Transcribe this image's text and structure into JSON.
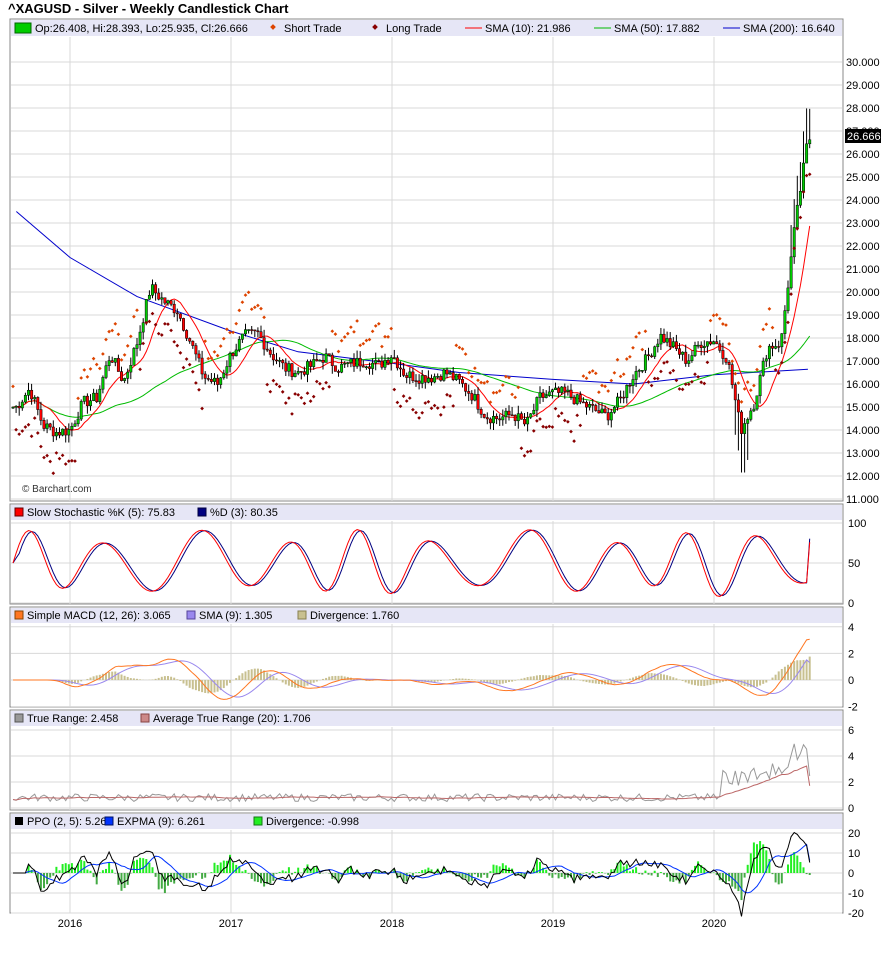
{
  "title": "^XAGUSD - Silver - Weekly Candlestick Chart",
  "colors": {
    "up": "#00cc00",
    "down": "#ff0000",
    "sma10": "#ff0000",
    "sma50": "#00bb00",
    "sma200": "#0000cc",
    "short": "#dd4400",
    "long": "#880000",
    "band": "#e6e6f6"
  },
  "chart_data": [
    {
      "panel": "price",
      "type": "candlestick",
      "legend": [
        "Op:26.408, Hi:28.393, Lo:25.935, Cl:26.666",
        "Short Trade",
        "Long Trade",
        "SMA (10): 21.986",
        "SMA (50): 17.882",
        "SMA (200): 16.640"
      ],
      "last_price_label": "26.666",
      "watermark": "© Barchart.com",
      "ylim": [
        11,
        30
      ],
      "yticks": [
        "11.000",
        "12.000",
        "13.000",
        "14.000",
        "15.000",
        "16.000",
        "17.000",
        "18.000",
        "19.000",
        "20.000",
        "21.000",
        "22.000",
        "23.000",
        "24.000",
        "25.000",
        "26.000",
        "27.000",
        "28.000",
        "29.000",
        "30.000"
      ],
      "xticks": [
        "2016",
        "2017",
        "2018",
        "2019",
        "2020"
      ],
      "close_points": [
        [
          "2015-09",
          15.0
        ],
        [
          "2015-10",
          15.8
        ],
        [
          "2015-11",
          14.2
        ],
        [
          "2015-12",
          13.9
        ],
        [
          "2016-01",
          14.0
        ],
        [
          "2016-02",
          15.2
        ],
        [
          "2016-03",
          15.4
        ],
        [
          "2016-04",
          17.3
        ],
        [
          "2016-05",
          16.1
        ],
        [
          "2016-06",
          17.8
        ],
        [
          "2016-07",
          20.2
        ],
        [
          "2016-08",
          19.6
        ],
        [
          "2016-09",
          19.2
        ],
        [
          "2016-10",
          17.8
        ],
        [
          "2016-11",
          16.3
        ],
        [
          "2016-12",
          16.0
        ],
        [
          "2017-01",
          17.3
        ],
        [
          "2017-02",
          18.1
        ],
        [
          "2017-03",
          18.2
        ],
        [
          "2017-04",
          17.3
        ],
        [
          "2017-05",
          16.7
        ],
        [
          "2017-06",
          16.5
        ],
        [
          "2017-07",
          16.8
        ],
        [
          "2017-08",
          17.2
        ],
        [
          "2017-09",
          16.7
        ],
        [
          "2017-10",
          16.9
        ],
        [
          "2017-11",
          17.0
        ],
        [
          "2017-12",
          16.8
        ],
        [
          "2018-01",
          17.3
        ],
        [
          "2018-02",
          16.4
        ],
        [
          "2018-03",
          16.3
        ],
        [
          "2018-04",
          16.3
        ],
        [
          "2018-05",
          16.5
        ],
        [
          "2018-06",
          16.1
        ],
        [
          "2018-07",
          15.5
        ],
        [
          "2018-08",
          14.6
        ],
        [
          "2018-09",
          14.5
        ],
        [
          "2018-10",
          14.7
        ],
        [
          "2018-11",
          14.2
        ],
        [
          "2018-12",
          15.4
        ],
        [
          "2019-01",
          15.6
        ],
        [
          "2019-02",
          15.6
        ],
        [
          "2019-03",
          15.2
        ],
        [
          "2019-04",
          14.9
        ],
        [
          "2019-05",
          14.6
        ],
        [
          "2019-06",
          15.3
        ],
        [
          "2019-07",
          16.4
        ],
        [
          "2019-08",
          17.1
        ],
        [
          "2019-09",
          18.1
        ],
        [
          "2019-10",
          17.6
        ],
        [
          "2019-11",
          17.0
        ],
        [
          "2019-12",
          17.8
        ],
        [
          "2020-01",
          17.9
        ],
        [
          "2020-02",
          17.1
        ],
        [
          "2020-03",
          14.0
        ],
        [
          "2020-04",
          15.2
        ],
        [
          "2020-05",
          17.6
        ],
        [
          "2020-06",
          17.8
        ],
        [
          "2020-07",
          22.7
        ],
        [
          "2020-08",
          26.666
        ]
      ],
      "sma200_points": [
        [
          "2015-09",
          23.5
        ],
        [
          "2016-01",
          21.5
        ],
        [
          "2016-06",
          19.8
        ],
        [
          "2017-01",
          18.3
        ],
        [
          "2017-06",
          17.4
        ],
        [
          "2018-01",
          16.9
        ],
        [
          "2018-06",
          16.5
        ],
        [
          "2019-01",
          16.2
        ],
        [
          "2019-07",
          16.0
        ],
        [
          "2020-01",
          16.4
        ],
        [
          "2020-08",
          16.64
        ]
      ]
    },
    {
      "panel": "stochastic",
      "type": "line",
      "legend": [
        "Slow Stochastic %K (5): 75.83",
        "%D (3): 80.35"
      ],
      "ylim": [
        0,
        100
      ],
      "yticks": [
        "0",
        "50",
        "100"
      ],
      "series": [
        {
          "name": "Slow Stochastic %K (5)",
          "last": 75.83
        },
        {
          "name": "%D (3)",
          "last": 80.35
        }
      ]
    },
    {
      "panel": "macd",
      "type": "line",
      "legend": [
        "Simple MACD (12, 26): 3.065",
        "SMA (9): 1.305",
        "Divergence: 1.760"
      ],
      "ylim": [
        -2,
        4
      ],
      "yticks": [
        "-2",
        "0",
        "2",
        "4"
      ],
      "series": [
        {
          "name": "Simple MACD (12, 26)",
          "last": 3.065
        },
        {
          "name": "SMA (9)",
          "last": 1.305
        },
        {
          "name": "Divergence",
          "last": 1.76
        }
      ]
    },
    {
      "panel": "true_range",
      "type": "line",
      "legend": [
        "True Range: 2.458",
        "Average True Range (20): 1.706"
      ],
      "ylim": [
        0,
        6
      ],
      "yticks": [
        "0",
        "2",
        "4",
        "6"
      ],
      "series": [
        {
          "name": "True Range",
          "last": 2.458
        },
        {
          "name": "Average True Range (20)",
          "last": 1.706
        }
      ]
    },
    {
      "panel": "ppo",
      "type": "line",
      "legend": [
        "PPO (2, 5): 5.263",
        "EXPMA (9): 6.261",
        "Divergence: -0.998"
      ],
      "ylim": [
        -20,
        20
      ],
      "yticks": [
        "-20",
        "-10",
        "0",
        "10",
        "20"
      ],
      "series": [
        {
          "name": "PPO (2, 5)",
          "last": 5.263
        },
        {
          "name": "EXPMA (9)",
          "last": 6.261
        },
        {
          "name": "Divergence",
          "last": -0.998
        }
      ]
    }
  ]
}
